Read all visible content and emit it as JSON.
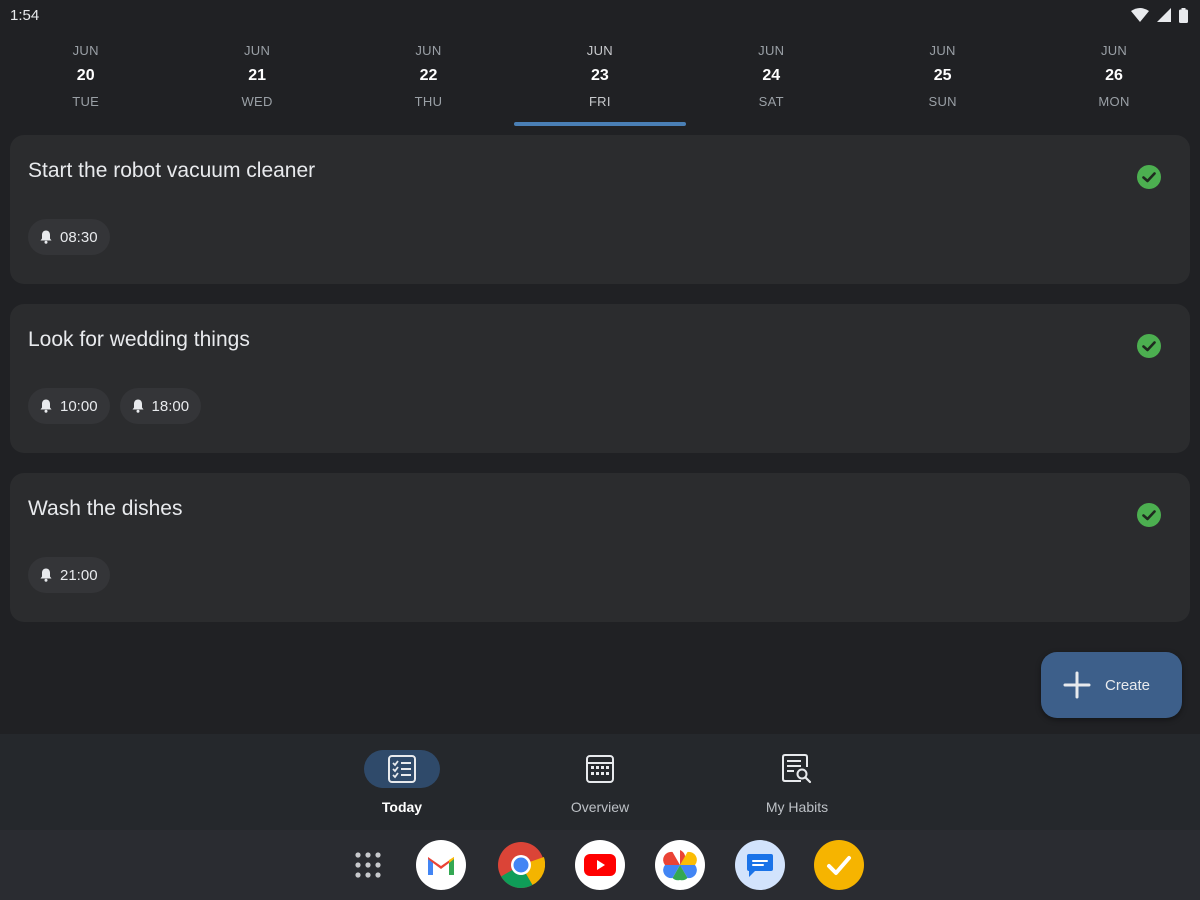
{
  "status_bar": {
    "time": "1:54"
  },
  "dates": [
    {
      "month": "JUN",
      "day": "20",
      "weekday": "TUE",
      "active": false
    },
    {
      "month": "JUN",
      "day": "21",
      "weekday": "WED",
      "active": false
    },
    {
      "month": "JUN",
      "day": "22",
      "weekday": "THU",
      "active": false
    },
    {
      "month": "JUN",
      "day": "23",
      "weekday": "FRI",
      "active": true
    },
    {
      "month": "JUN",
      "day": "24",
      "weekday": "SAT",
      "active": false
    },
    {
      "month": "JUN",
      "day": "25",
      "weekday": "SUN",
      "active": false
    },
    {
      "month": "JUN",
      "day": "26",
      "weekday": "MON",
      "active": false
    }
  ],
  "tasks": [
    {
      "title": "Start the robot vacuum cleaner",
      "reminders": [
        "08:30"
      ],
      "completed": true
    },
    {
      "title": "Look for wedding things",
      "reminders": [
        "10:00",
        "18:00"
      ],
      "completed": true
    },
    {
      "title": "Wash the dishes",
      "reminders": [
        "21:00"
      ],
      "completed": true
    }
  ],
  "fab": {
    "label": "Create",
    "icon": "plus-icon"
  },
  "bottom_nav": {
    "items": [
      {
        "label": "Today",
        "icon": "checklist-icon",
        "active": true
      },
      {
        "label": "Overview",
        "icon": "calendar-grid-icon",
        "active": false
      },
      {
        "label": "My Habits",
        "icon": "list-search-icon",
        "active": false
      }
    ]
  },
  "dock": {
    "apps": [
      "app-drawer-icon",
      "gmail-icon",
      "chrome-icon",
      "youtube-icon",
      "photos-icon",
      "messages-icon",
      "tasks-app-icon"
    ]
  },
  "colors": {
    "background": "#202124",
    "card": "#2b2c2e",
    "accent": "#4a7fb5",
    "check_green": "#4caf50",
    "fab": "#3d5f8a"
  }
}
